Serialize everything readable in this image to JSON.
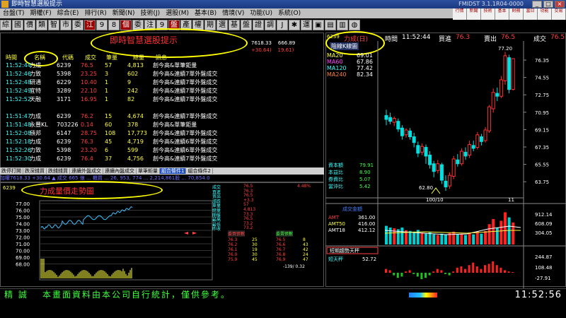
{
  "window": {
    "title": "即時智慧選股提示",
    "right_title": "FMIDST 3.1.1R04-0000"
  },
  "menu": [
    "台盤(T)",
    "期權(F)",
    "綜合(E)",
    "排行(R)",
    "新聞(N)",
    "技術(J)",
    "選股(M)",
    "基本(B)",
    "情境(V)",
    "功能(U)",
    "系統(O)"
  ],
  "right_toolbar": [
    "行情",
    "新聞",
    "技術",
    "基本",
    "財務",
    "當日",
    "功能",
    "交易"
  ],
  "quickbar": [
    "綜",
    "國",
    "價",
    "類",
    "智",
    "市",
    "委",
    "江",
    "9",
    "8",
    "個",
    "委",
    "注",
    "9",
    "盤",
    "產",
    "權",
    "期",
    "選",
    "基",
    "盤",
    "證",
    "調",
    "J",
    "✱",
    "運",
    "▣",
    "▤",
    "▥",
    "◍"
  ],
  "left_top": {
    "title": "即時智慧選股提示",
    "index_values": [
      {
        "a": "7618.33",
        "b": "666.89"
      },
      {
        "a": "+30.64)",
        "b": "19.61)"
      }
    ],
    "headers": [
      "時間",
      "名稱",
      "代碼",
      "成交",
      "筆量",
      "總量",
      "訊息"
    ],
    "rows": [
      {
        "time": "11:52:44",
        "name": "力成",
        "code": "6239",
        "price": "76.5",
        "lot": "57",
        "vol": "4,813",
        "msg": "創今高&單筆鉅量"
      },
      {
        "time": "11:52:46",
        "name": "力致",
        "code": "5398",
        "price": "23.25",
        "lot": "3",
        "vol": "602",
        "msg": "創今高&連續7單外盤成交"
      },
      {
        "time": "11:52:48",
        "name": "研通",
        "code": "6229",
        "price": "10.40",
        "lot": "1",
        "vol": "9",
        "msg": "創今高&連續7單外盤成交"
      },
      {
        "time": "11:52:49",
        "name": "宜特",
        "code": "3289",
        "price": "22.10",
        "lot": "1",
        "vol": "242",
        "msg": "創今高&連續7單外盤成交"
      },
      {
        "time": "11:52:52",
        "name": "天融",
        "code": "3171",
        "price": "16.95",
        "lot": "1",
        "vol": "82",
        "msg": "創今高&連續7單外盤成交"
      },
      {
        "time": "",
        "name": "",
        "code": "",
        "price": "",
        "lot": "",
        "vol": "",
        "msg": ""
      },
      {
        "time": "11:51:47",
        "name": "力成",
        "code": "6239",
        "price": "76.2",
        "lot": "15",
        "vol": "4,674",
        "msg": "創今高&連續7單外盤成交"
      },
      {
        "time": "11:51:48",
        "name": "永豐KL",
        "code": "703226",
        "price": "0.14",
        "lot": "60",
        "vol": "378",
        "msg": "創今高&單筆鉅量"
      },
      {
        "time": "11:52:08",
        "name": "頎邦",
        "code": "6147",
        "price": "28.75",
        "lot": "108",
        "vol": "17,773",
        "msg": "創今高&連續7單外盤成交"
      },
      {
        "time": "11:52:18",
        "name": "力成",
        "code": "6239",
        "price": "76.3",
        "lot": "45",
        "vol": "4,719",
        "msg": "創今高&連續6單外盤成交"
      },
      {
        "time": "11:52:26",
        "name": "力致",
        "code": "5398",
        "price": "23.20",
        "lot": "6",
        "vol": "599",
        "msg": "創今高&連續6單外盤成交"
      },
      {
        "time": "11:52:30",
        "name": "力成",
        "code": "6239",
        "price": "76.4",
        "lot": "37",
        "vol": "4,756",
        "msg": "創今高&連續7單外盤成交"
      }
    ],
    "tabs": [
      "跌停打開",
      "跌深錢買",
      "跌錢錢買",
      "連續外盤成交",
      "連續內盤成交",
      "單筆鉅量",
      "組合條件1",
      "組合條件2"
    ],
    "ticker": "加權7618.33 +30.64 ▲ 成交 665 億 ... 櫃買 ... 26, 953, 774 ... 2,214,861股 ... 70,854.0"
  },
  "right": {
    "code": "6239",
    "name": "力成(日)",
    "time_label": "時間",
    "time": "11:52:44",
    "bid_label": "買進",
    "bid": "76.3",
    "ask_label": "賣出",
    "ask": "76.5",
    "last_label": "成交",
    "last": "76.5",
    "chart_title": "陰線K線圖",
    "ma": [
      {
        "label": "MA20",
        "value": "69.01"
      },
      {
        "label": "MA60",
        "value": "67.86"
      },
      {
        "label": "MA120",
        "value": "77.42"
      },
      {
        "label": "MA240",
        "value": "82.34"
      }
    ],
    "price_ticks": [
      "76.35",
      "74.55",
      "72.75",
      "70.95",
      "69.15",
      "67.35",
      "65.55",
      "63.75"
    ],
    "high_label": "77.20",
    "low_label": "62.80",
    "date_label": "100/10",
    "month_label": "11",
    "fund": [
      {
        "label": "資本額",
        "value": "79.91"
      },
      {
        "label": "本益比",
        "value": "8.90"
      },
      {
        "label": "券資比",
        "value": "5.07"
      },
      {
        "label": "當沖比",
        "value": "5.42"
      }
    ],
    "vol_title": "成交金額",
    "amt": [
      {
        "label": "AMT",
        "value": "361.00"
      },
      {
        "label": "AMT50",
        "value": "416.00"
      },
      {
        "label": "AMT18",
        "value": "412.12"
      }
    ],
    "vol_ticks": [
      "912.14",
      "608.09",
      "304.05"
    ],
    "osc_title": "短期趨勢天秤",
    "osc_label": "短天秤",
    "osc_value": "52.72",
    "osc_ticks": [
      "244.87",
      "108.48",
      "-27.91"
    ]
  },
  "bottom_left": {
    "code": "6239",
    "title": "力成量價走勢圖",
    "price_ticks": [
      "77.00",
      "76.00",
      "75.00",
      "74.00",
      "73.00",
      "72.00",
      "71.00",
      "70.00",
      "69.00",
      "68.00"
    ],
    "quote_labels": [
      "成交",
      "買進",
      "賣出",
      "漲跌",
      "單量",
      "總量",
      "開盤",
      "最高",
      "最低",
      "昨收"
    ],
    "quote_values": [
      "76.5",
      "76.3",
      "76.5",
      "+3.3",
      "57",
      "4,813",
      "73.3",
      "76.5",
      "73.2",
      "73.2"
    ],
    "quote_pcts": [
      "4.48%",
      "",
      "",
      "",
      "",
      "",
      "",
      "",
      "",
      ""
    ],
    "bid_header": "委買張數",
    "ask_header": "委賣張數",
    "bid_prices": [
      "76.3",
      "76.2",
      "76.1",
      "76.0",
      "75.9"
    ],
    "bid_qty": [
      "25",
      "30",
      "19",
      "30",
      "45"
    ],
    "ask_prices": [
      "76.5",
      "76.6",
      "76.7",
      "76.8",
      "76.9"
    ],
    "ask_qty": [
      "8",
      "43",
      "42",
      "24",
      "47"
    ],
    "footer": "-139/ 0.32"
  },
  "status": {
    "left": "精 誠",
    "message": "本畫面資料由本公司自行統計，僅供參考。",
    "clock": "11:52:56"
  }
}
